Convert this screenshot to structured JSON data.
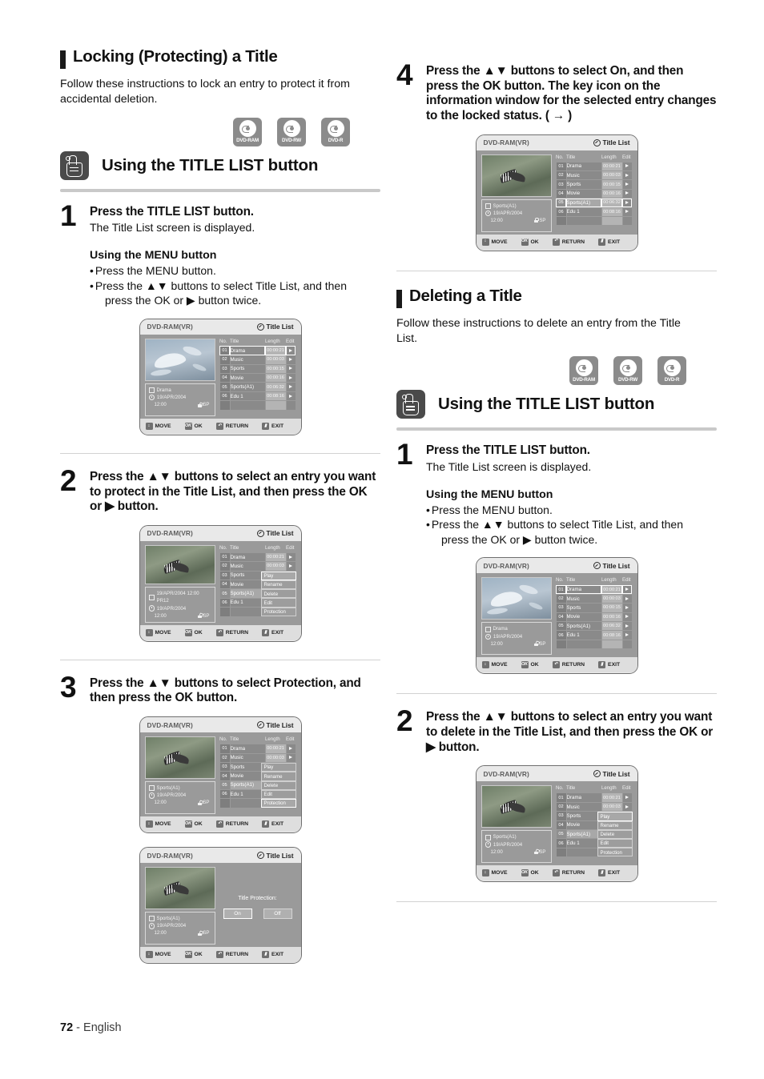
{
  "page": {
    "number": "72",
    "separator": "-",
    "language": "English"
  },
  "left": {
    "section": {
      "title": "Locking (Protecting) a Title",
      "intro": "Follow these instructions to lock an entry to protect it from accidental deletion."
    },
    "media": [
      {
        "label": "DVD-RAM"
      },
      {
        "label": "DVD-RW"
      },
      {
        "label": "DVD-R"
      }
    ],
    "banner": "Using the TITLE LIST button",
    "steps": [
      {
        "num": "1",
        "title": "Press the TITLE LIST button.",
        "sub": "The Title List screen is displayed.",
        "menu_heading": "Using the MENU button",
        "menu_items": [
          "Press the MENU button.",
          "Press the ▲▼ buttons to select Title List, and then",
          "press the OK or ▶ button twice."
        ]
      },
      {
        "num": "2",
        "title": "Press the ▲▼ buttons to select an entry you want to protect in the Title List, and then press the OK or ▶ button."
      },
      {
        "num": "3",
        "title": "Press the ▲▼ buttons to select Protection, and then press the OK button."
      }
    ]
  },
  "right": {
    "step4": {
      "num": "4",
      "title": "Press the ▲▼ buttons to select On, and then press the OK button. The key icon on the information window for the selected entry changes to the locked status. ( → )"
    },
    "section": {
      "title": "Deleting a Title",
      "intro": "Follow these instructions to delete an entry from the Title List."
    },
    "media": [
      {
        "label": "DVD-RAM"
      },
      {
        "label": "DVD-RW"
      },
      {
        "label": "DVD-R"
      }
    ],
    "banner": "Using the TITLE LIST button",
    "steps": [
      {
        "num": "1",
        "title": "Press the TITLE LIST button.",
        "sub": "The Title List screen is displayed.",
        "menu_heading": "Using the MENU button",
        "menu_items": [
          "Press the MENU button.",
          "Press the ▲▼ buttons to select Title List, and then",
          "press the OK or ▶ button twice."
        ]
      },
      {
        "num": "2",
        "title": "Press the ▲▼ buttons to select an entry you want to delete in the Title List, and then press the OK or ▶ button."
      }
    ]
  },
  "osd": {
    "source": "DVD-RAM(VR)",
    "title_list": "Title List",
    "columns": {
      "no": "No.",
      "title": "Title",
      "length": "Length",
      "edit": "Edit"
    },
    "rows": [
      {
        "no": "01",
        "title": "Drama",
        "length": "00:00:21"
      },
      {
        "no": "02",
        "title": "Music",
        "length": "00:00:03"
      },
      {
        "no": "03",
        "title": "Sports",
        "length": "00:00:15"
      },
      {
        "no": "04",
        "title": "Movie",
        "length": "00:00:16"
      },
      {
        "no": "05",
        "title": "Sports(A1)",
        "length": "00:06:32"
      },
      {
        "no": "06",
        "title": "Edu 1",
        "length": "00:08:16"
      }
    ],
    "popup_menu": [
      "Play",
      "Rename",
      "Delete",
      "Edit",
      "Protection"
    ],
    "info_drama": {
      "name": "Drama",
      "date": "19/APR/2004",
      "time": "12:00",
      "mode": "SP"
    },
    "info_sports": {
      "name": "Sports(A1)",
      "date": "19/APR/2004",
      "time": "12:00",
      "mode": "SP"
    },
    "info_pr12": {
      "name": "19/APR/2004 12:00 PR12",
      "date": "19/APR/2004",
      "time": "12:00",
      "mode": "SP"
    },
    "protection": {
      "label": "Title Protection:",
      "on": "On",
      "off": "Off"
    },
    "bottom_bar": [
      {
        "key": "↕",
        "label": "MOVE"
      },
      {
        "key": "OK",
        "label": "OK"
      },
      {
        "key": "↶",
        "label": "RETURN"
      },
      {
        "key": "▮",
        "label": "EXIT"
      }
    ]
  }
}
